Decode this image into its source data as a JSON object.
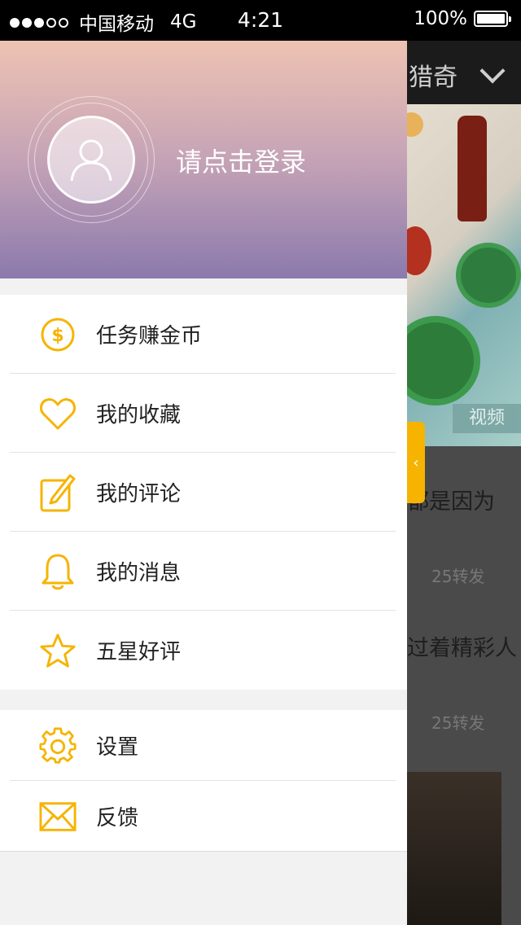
{
  "status_bar": {
    "carrier": "中国移动",
    "network": "4G",
    "time": "4:21",
    "battery": "100%",
    "signal_bars_filled": 3,
    "signal_bars_total": 5
  },
  "background": {
    "header_title": "猎奇",
    "video_tag": "视频",
    "articles": [
      {
        "title_fragment": "都是因为",
        "meta": "25转发"
      },
      {
        "title_fragment": "过着精彩人",
        "meta": "25转发"
      }
    ]
  },
  "drawer": {
    "login_text": "请点击登录",
    "menu": [
      {
        "label": "任务赚金币",
        "icon": "coin-icon"
      },
      {
        "label": "我的收藏",
        "icon": "heart-icon"
      },
      {
        "label": "我的评论",
        "icon": "edit-icon"
      },
      {
        "label": "我的消息",
        "icon": "bell-icon"
      },
      {
        "label": "五星好评",
        "icon": "star-icon"
      }
    ],
    "secondary_menu": [
      {
        "label": "设置",
        "icon": "gear-icon"
      },
      {
        "label": "反馈",
        "icon": "mail-icon"
      }
    ]
  },
  "colors": {
    "accent": "#f6b400",
    "profile_top": "#eec3b3",
    "profile_bottom": "#8b7aad"
  }
}
